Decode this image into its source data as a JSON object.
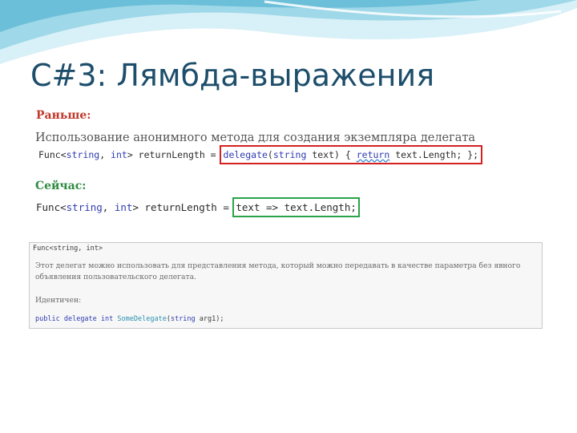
{
  "slide": {
    "title": "C#3: Лямбда-выражения",
    "before_label": "Раньше:",
    "description": "Использование анонимного метода для создания экземпляра делегата",
    "code_before": {
      "func": "Func",
      "lt": "<",
      "t1": "string",
      "comma": ", ",
      "t2": "int",
      "gt": "> returnLength = ",
      "delegate": "delegate",
      "params_open": "(",
      "ptype": "string",
      "params_rest": " text) { ",
      "ret": "return",
      "body": " text.Length; };"
    },
    "now_label": "Сейчас:",
    "code_now": {
      "func": "Func",
      "lt": "<",
      "t1": "string",
      "comma": ", ",
      "t2": "int",
      "gt": "> returnLength = ",
      "lambda": "text => text.Length;"
    },
    "tooltip": {
      "signature": "Func<string, int>",
      "text": "Этот делегат можно использовать для представления метода, который можно передавать в качестве параметра без явного объявления пользовательского делегата.",
      "identical": "Идентичен:",
      "code": {
        "kw1": "public",
        "kw2": "delegate",
        "kw3": "int",
        "name": "SomeDelegate",
        "open": "(",
        "kw4": "string",
        "rest": " arg1);"
      }
    },
    "colors": {
      "title": "#1d4e6b",
      "before_label": "#c0392b",
      "now_label": "#2e8b3f",
      "highlight_red": "#d62020",
      "highlight_green": "#2aa34a",
      "keyword": "#2f3cb0",
      "wave_light": "#bfe6f1",
      "wave_mid": "#7cc7de"
    }
  }
}
